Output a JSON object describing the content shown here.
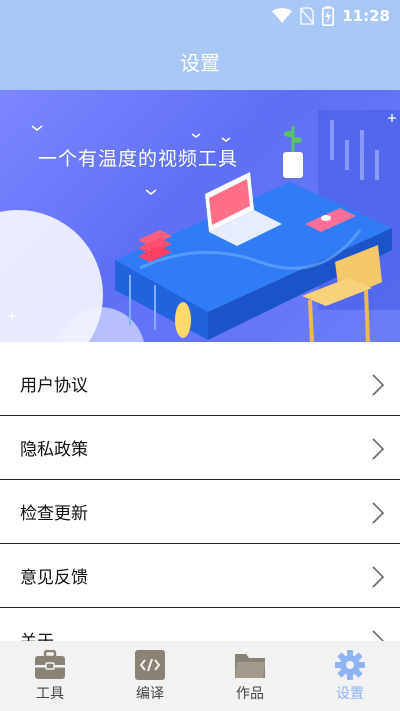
{
  "status_bar": {
    "time": "11:28",
    "icons": [
      "wifi-icon",
      "no-sim-icon",
      "battery-charging-icon"
    ]
  },
  "header": {
    "title": "设置"
  },
  "banner": {
    "headline": "一个有温度的视频工具"
  },
  "menu": {
    "items": [
      {
        "label": "用户协议",
        "icon": "chevron-right-icon"
      },
      {
        "label": "隐私政策",
        "icon": "chevron-right-icon"
      },
      {
        "label": "检查更新",
        "icon": "chevron-right-icon"
      },
      {
        "label": "意见反馈",
        "icon": "chevron-right-icon"
      },
      {
        "label": "关于",
        "icon": "chevron-right-icon"
      }
    ]
  },
  "tabbar": {
    "tabs": [
      {
        "label": "工具",
        "icon": "toolbox-icon",
        "active": false
      },
      {
        "label": "编译",
        "icon": "code-icon",
        "active": false
      },
      {
        "label": "作品",
        "icon": "folder-icon",
        "active": false
      },
      {
        "label": "设置",
        "icon": "gear-icon",
        "active": true
      }
    ]
  },
  "colors": {
    "header_bg": "#a9c7f5",
    "active_tab": "#8fb4f4",
    "inactive_icon": "#8a8275",
    "banner_bg": "#6b78f6"
  }
}
